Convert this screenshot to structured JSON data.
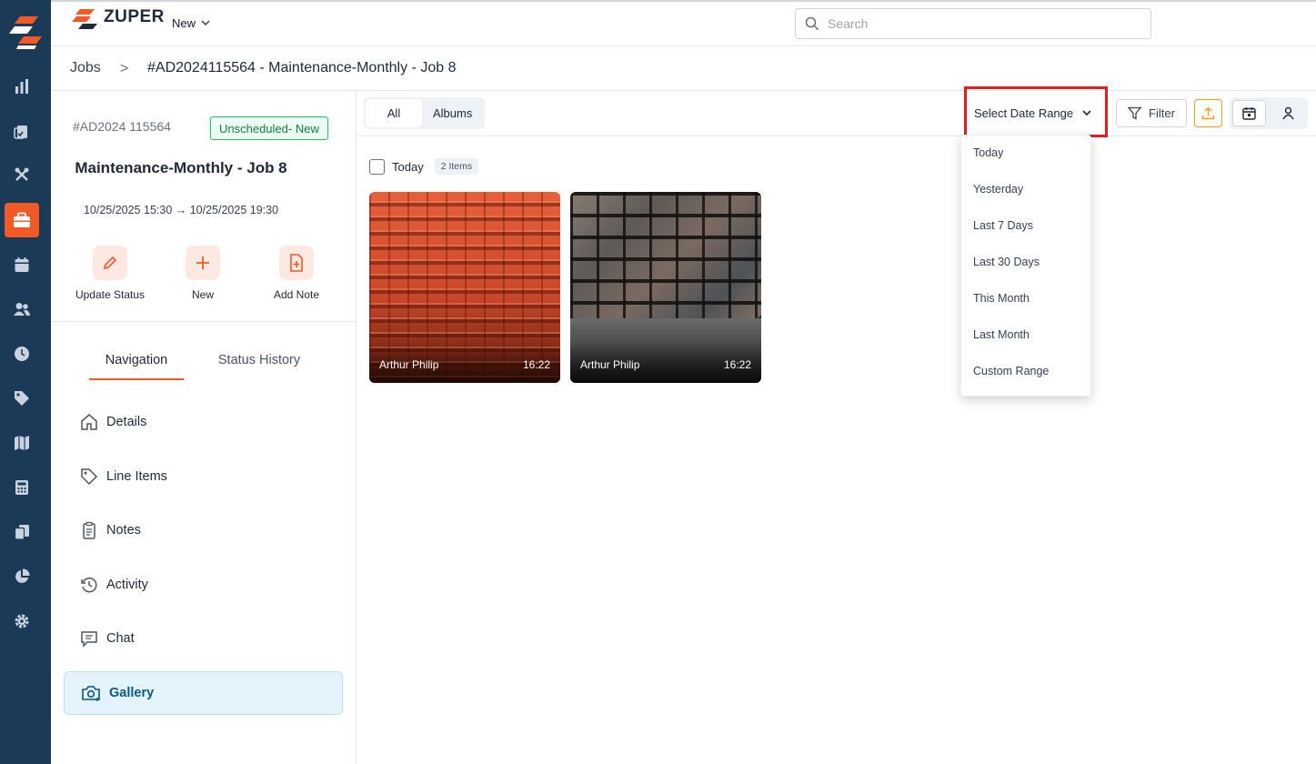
{
  "app": {
    "brand": "ZUPER",
    "new_menu_label": "New"
  },
  "search": {
    "placeholder": "Search",
    "value": ""
  },
  "breadcrumb": {
    "root": "Jobs",
    "separator": ">",
    "current": "#AD2024115564 - Maintenance-Monthly - Job 8"
  },
  "job": {
    "number": "#AD2024 115564",
    "status": "Unscheduled- New",
    "title": "Maintenance-Monthly - Job 8",
    "dates": "10/25/2025 15:30 → 10/25/2025 19:30"
  },
  "actions": [
    {
      "label": "Update Status",
      "icon": "pencil-icon"
    },
    {
      "label": "New",
      "icon": "plus-icon"
    },
    {
      "label": "Add Note",
      "icon": "note-add-icon"
    }
  ],
  "panel_tabs": {
    "navigation": "Navigation",
    "status_history": "Status History",
    "active": "Navigation"
  },
  "nav": [
    {
      "label": "Details",
      "icon": "home-icon"
    },
    {
      "label": "Line Items",
      "icon": "tag-icon"
    },
    {
      "label": "Notes",
      "icon": "clipboard-icon"
    },
    {
      "label": "Activity",
      "icon": "history-icon"
    },
    {
      "label": "Chat",
      "icon": "chat-icon"
    },
    {
      "label": "Gallery",
      "icon": "camera-icon",
      "active": true
    }
  ],
  "gallery": {
    "tabs": {
      "all": "All",
      "albums": "Albums",
      "active": "All"
    },
    "date_range_label": "Select Date Range",
    "filter_label": "Filter",
    "group": {
      "label": "Today",
      "count": "2 Items"
    },
    "photos": [
      {
        "author": "Arthur Philip",
        "time": "16:22",
        "subject": "red clay roof tiles"
      },
      {
        "author": "Arthur Philip",
        "time": "16:22",
        "subject": "slate roof shingles"
      }
    ]
  },
  "date_range_options": [
    "Today",
    "Yesterday",
    "Last 7 Days",
    "Last 30 Days",
    "This Month",
    "Last Month",
    "Custom Range"
  ],
  "colors": {
    "rail": "#1b3a57",
    "accent": "#f15a24",
    "highlight": "#e11d24",
    "status_green": "#15803d"
  }
}
